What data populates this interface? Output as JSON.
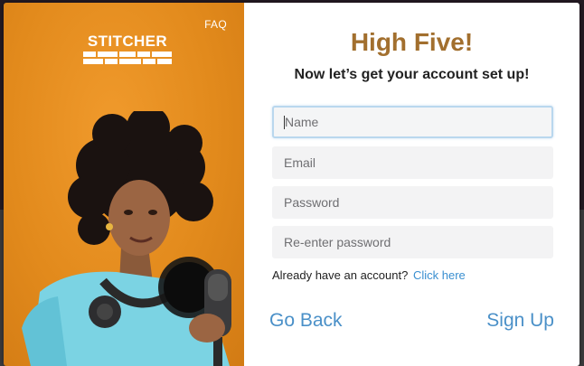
{
  "promo": {
    "faq_label": "FAQ",
    "logo_text": "STITCHER",
    "accent_color": "#e38b1d"
  },
  "form": {
    "headline": "High Five!",
    "subhead": "Now let’s get your account set up!",
    "fields": [
      {
        "placeholder": "Name",
        "value": "",
        "focused": true
      },
      {
        "placeholder": "Email",
        "value": ""
      },
      {
        "placeholder": "Password",
        "value": ""
      },
      {
        "placeholder": "Re-enter password",
        "value": ""
      }
    ],
    "login_prompt": "Already have an account?",
    "login_link": "Click here",
    "back_label": "Go Back",
    "signup_label": "Sign Up",
    "headline_color": "#a26f2e",
    "link_color": "#4a90c8"
  }
}
